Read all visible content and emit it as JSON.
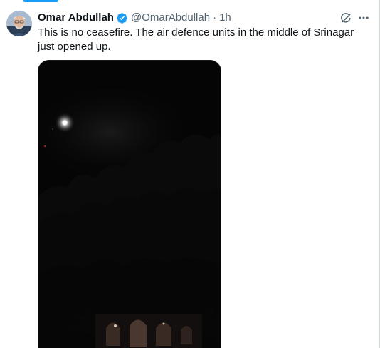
{
  "tweet": {
    "author_name": "Omar Abdullah",
    "handle": "@OmarAbdullah",
    "separator": "·",
    "time": "1h",
    "text": "This is no ceasefire. The air defence units in the middle of Srinagar just opened up."
  },
  "icons": {
    "verified": "verified-badge-icon",
    "grok": "grok-icon",
    "more": "more-options-icon"
  },
  "colors": {
    "verified_blue": "#1d9bf0",
    "text_primary": "#0f1419",
    "text_secondary": "#536471",
    "tab_indicator": "#1d9bf0",
    "video_background": "#050505"
  }
}
